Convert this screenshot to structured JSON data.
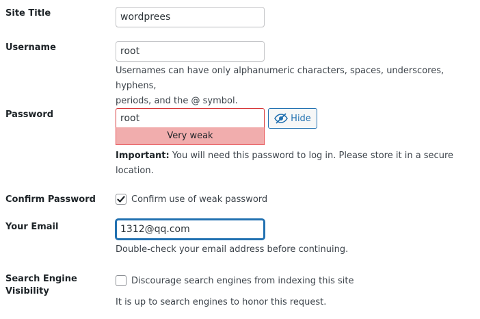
{
  "site_title": {
    "label": "Site Title",
    "value": "wordprees"
  },
  "username": {
    "label": "Username",
    "value": "root",
    "description_line1": "Usernames can have only alphanumeric characters, spaces, underscores, hyphens,",
    "description_line2": "periods, and the @ symbol."
  },
  "password": {
    "label": "Password",
    "value": "root",
    "strength": "Very weak",
    "toggle_label": "Hide",
    "toggle_icon": "eye-slash-icon",
    "important_label": "Important:",
    "important_text_line1": " You will need this password to log in. Please store it in a secure",
    "important_text_line2": "location."
  },
  "confirm_password": {
    "label": "Confirm Password",
    "checkbox_label": "Confirm use of weak password",
    "checked": true
  },
  "email": {
    "label": "Your Email",
    "value": "1312@qq.com",
    "description": "Double-check your email address before continuing."
  },
  "search_visibility": {
    "label_line1": "Search Engine",
    "label_line2": "Visibility",
    "checkbox_label": "Discourage search engines from indexing this site",
    "checked": false,
    "description": "It is up to search engines to honor this request."
  },
  "colors": {
    "accent": "#2271b1",
    "weak_bg": "#f1adad",
    "weak_border": "#e65054"
  }
}
